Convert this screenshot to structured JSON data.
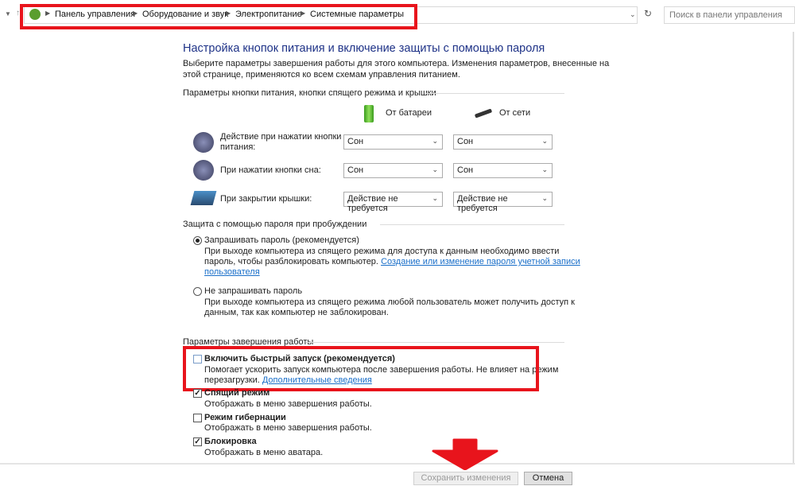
{
  "address_bar": {
    "breadcrumbs": [
      "Панель управления",
      "Оборудование и звук",
      "Электропитание",
      "Системные параметры"
    ],
    "search_placeholder": "Поиск в панели управления"
  },
  "title": "Настройка кнопок питания и включение защиты с помощью пароля",
  "description": [
    "Выберите параметры завершения работы для этого компьютера. Изменения параметров, внесенные на",
    "этой странице, применяются ко всем схемам управления питанием."
  ],
  "buttons_section": {
    "header": "Параметры кнопки питания, кнопки спящего режима и крышки",
    "col_battery": "От батареи",
    "col_power": "От сети",
    "rows": [
      {
        "label1": "Действие при нажатии кнопки",
        "label2": "питания:",
        "battery": "Сон",
        "power": "Сон"
      },
      {
        "label1": "При нажатии кнопки сна:",
        "label2": "",
        "battery": "Сон",
        "power": "Сон"
      },
      {
        "label1": "При закрытии крышки:",
        "label2": "",
        "battery": "Действие не требуется",
        "power": "Действие не требуется"
      }
    ]
  },
  "password_section": {
    "header": "Защита с помощью пароля при пробуждении",
    "opt1": {
      "label": "Запрашивать пароль (рекомендуется)",
      "line1": "При выходе компьютера из спящего режима для доступа к данным необходимо ввести",
      "line2": "пароль, чтобы разблокировать компьютер.",
      "link1": "Создание или изменение пароля учетной записи",
      "link2": "пользователя",
      "selected": true
    },
    "opt2": {
      "label": "Не запрашивать пароль",
      "line1": "При выходе компьютера из спящего режима любой пользователь может получить доступ к",
      "line2": "данным, так как компьютер не заблокирован.",
      "selected": false
    }
  },
  "shutdown_section": {
    "header": "Параметры завершения работы",
    "items": [
      {
        "label": "Включить быстрый запуск (рекомендуется)",
        "line1": "Помогает ускорить запуск компьютера после завершения работы. Не влияет на режим",
        "line2": "перезагрузки.",
        "link": "Дополнительные сведения",
        "checked": false
      },
      {
        "label": "Спящий режим",
        "line1": "Отображать в меню завершения работы.",
        "checked": true
      },
      {
        "label": "Режим гибернации",
        "line1": "Отображать в меню завершения работы.",
        "checked": false
      },
      {
        "label": "Блокировка",
        "line1": "Отображать в меню аватара.",
        "checked": true
      }
    ]
  },
  "footer": {
    "save": "Сохранить изменения",
    "cancel": "Отмена"
  },
  "colors": {
    "highlight": "#e8141c",
    "title": "#1e3287",
    "link": "#1a6fc9"
  }
}
